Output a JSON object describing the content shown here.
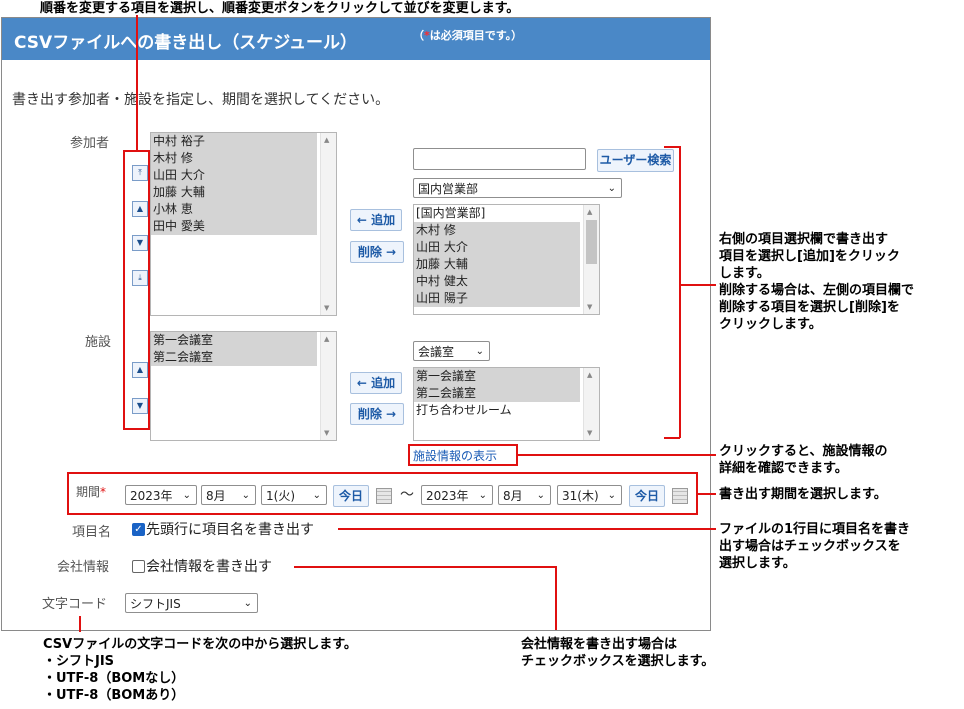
{
  "annotations": {
    "top": "順番を変更する項目を選択し、順番変更ボタンをクリックして並びを変更します。",
    "right_select": [
      "右側の項目選択欄で書き出す",
      "項目を選択し[追加]をクリック",
      "します。",
      "削除する場合は、左側の項目欄で",
      "削除する項目を選択し[削除]を",
      "クリックします。"
    ],
    "facility_info": [
      "クリックすると、施設情報の",
      "詳細を確認できます。"
    ],
    "period": "書き出す期間を選択します。",
    "item_name": [
      "ファイルの1行目に項目名を書き",
      "出す場合はチェックボックスを",
      "選択します。"
    ],
    "encoding": [
      "CSVファイルの文字コードを次の中から選択します。",
      "・シフトJIS",
      "・UTF-8（BOMなし）",
      "・UTF-8（BOMあり）"
    ],
    "company": [
      "会社情報を書き出す場合は",
      "チェックボックスを選択します。"
    ]
  },
  "header": {
    "title": "CSVファイルへの書き出し（スケジュール）",
    "required_prefix": "（",
    "required_mark": "*",
    "required_text": "は必須項目です。）"
  },
  "intro": "書き出す参加者・施設を指定し、期間を選択してください。",
  "participants": {
    "label": "参加者",
    "selected": [
      "中村 裕子",
      "木村 修",
      "山田 大介",
      "加藤 大輔",
      "小林 恵",
      "田中 愛美"
    ],
    "search_value": "",
    "search_button": "ユーザー検索",
    "group": "国内営業部",
    "candidates": [
      "[国内営業部]",
      "木村 修",
      "山田 大介",
      "加藤 大輔",
      "中村 健太",
      "山田 陽子"
    ],
    "add_button": "← 追加",
    "remove_button": "削除 →"
  },
  "facilities": {
    "label": "施設",
    "selected": [
      "第一会議室",
      "第二会議室"
    ],
    "group": "会議室",
    "candidates": [
      "第一会議室",
      "第二会議室",
      "打ち合わせルーム"
    ],
    "add_button": "← 追加",
    "remove_button": "削除 →",
    "info_link": "施設情報の表示"
  },
  "period": {
    "label": "期間",
    "required_mark": "*",
    "start": {
      "year": "2023年",
      "month": "8月",
      "day": "1(火)"
    },
    "end": {
      "year": "2023年",
      "month": "8月",
      "day": "31(木)"
    },
    "today_button": "今日",
    "separator": "〜"
  },
  "item_name": {
    "label": "項目名",
    "checkbox_label": "先頭行に項目名を書き出す",
    "checked": true
  },
  "company_info": {
    "label": "会社情報",
    "checkbox_label": "会社情報を書き出す",
    "checked": false
  },
  "encoding": {
    "label": "文字コード",
    "value": "シフトJIS"
  },
  "colors": {
    "header": "#4a88c7",
    "annotation_line": "#e01010",
    "link": "#1a5bb5"
  },
  "icons": [
    "move-top-icon",
    "move-up-icon",
    "move-down-icon",
    "move-bottom-icon",
    "calendar-icon",
    "checkbox-icon",
    "chevron-down-icon"
  ]
}
